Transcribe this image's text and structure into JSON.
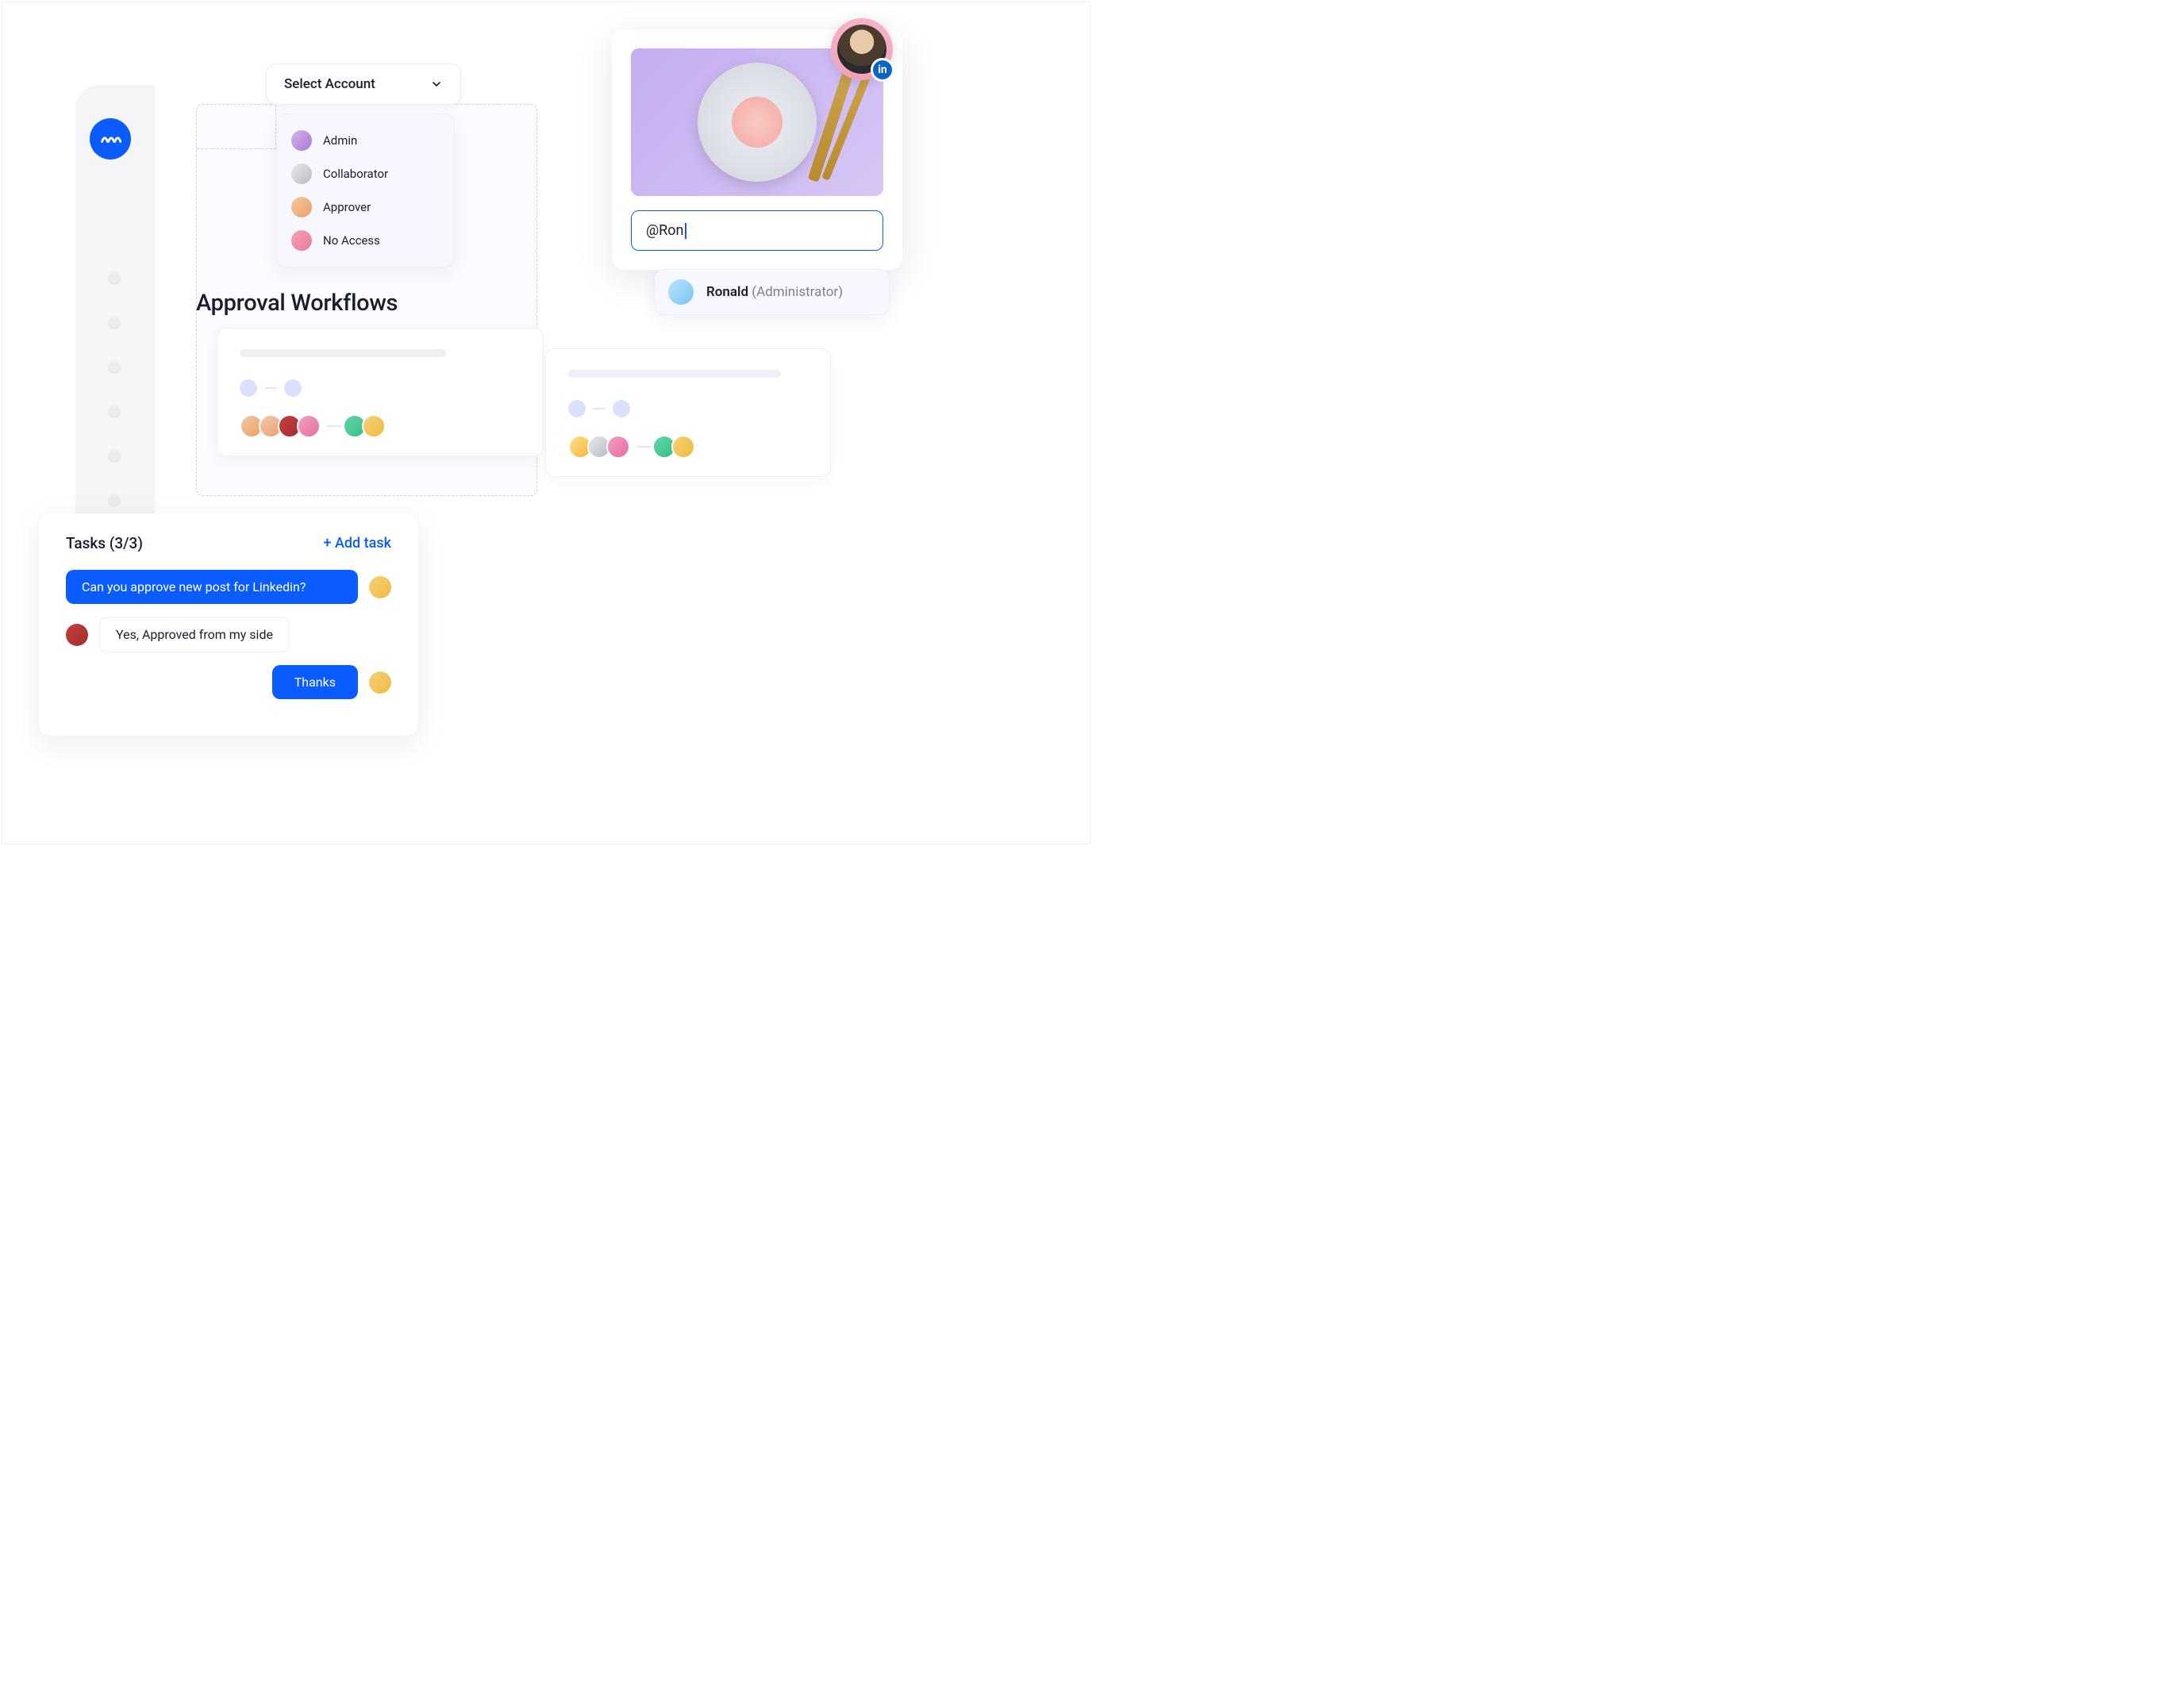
{
  "select": {
    "label": "Select Account"
  },
  "roles": {
    "items": [
      {
        "label": "Admin"
      },
      {
        "label": "Collaborator"
      },
      {
        "label": "Approver"
      },
      {
        "label": "No Access"
      }
    ]
  },
  "section": {
    "title": "Approval Workflows"
  },
  "tasks": {
    "title": "Tasks (3/3)",
    "add_label": "+ Add task",
    "messages": [
      {
        "text": "Can you approve new post for Linkedin?"
      },
      {
        "text": "Yes, Approved from my side"
      },
      {
        "text": "Thanks"
      }
    ]
  },
  "mention": {
    "input_value": "@Ron",
    "suggestion": {
      "name": "Ronald",
      "role": "(Administrator)"
    }
  },
  "badges": {
    "linkedin": "in"
  }
}
